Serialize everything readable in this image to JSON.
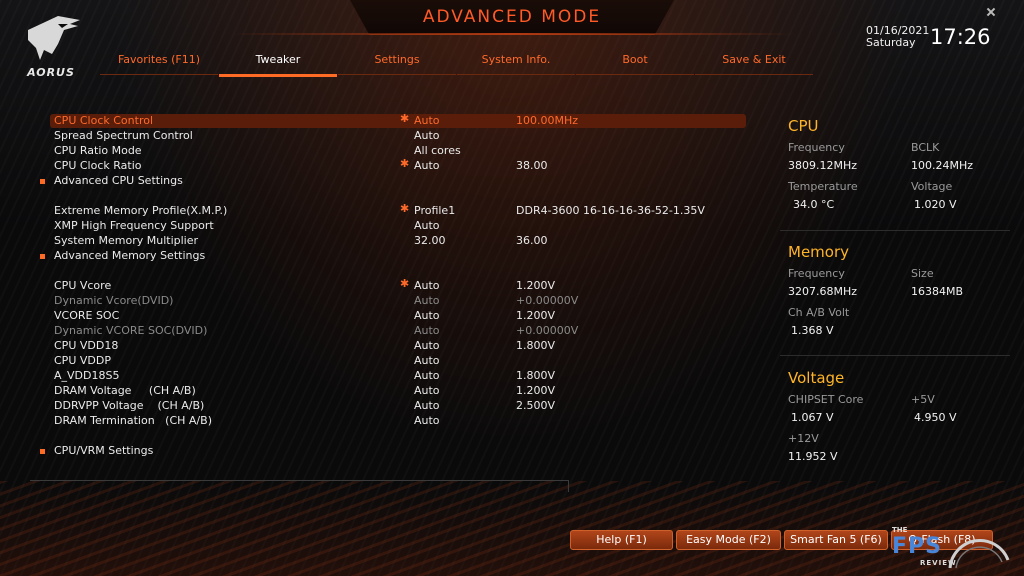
{
  "header": {
    "title": "ADVANCED MODE",
    "logo_text": "AORUS",
    "date": "01/16/2021",
    "weekday": "Saturday",
    "time": "17:26"
  },
  "tabs": [
    {
      "label": "Favorites (F11)",
      "active": false
    },
    {
      "label": "Tweaker",
      "active": true
    },
    {
      "label": "Settings",
      "active": false
    },
    {
      "label": "System Info.",
      "active": false
    },
    {
      "label": "Boot",
      "active": false
    },
    {
      "label": "Save & Exit",
      "active": false
    }
  ],
  "settings": [
    {
      "label": "CPU Clock Control",
      "star": true,
      "value": "Auto",
      "value2": "100.00MHz",
      "selected": true
    },
    {
      "label": "Spread Spectrum Control",
      "value": "Auto"
    },
    {
      "label": "CPU Ratio Mode",
      "value": "All cores"
    },
    {
      "label": "CPU Clock Ratio",
      "star": true,
      "value": "Auto",
      "value2": "38.00"
    },
    {
      "label": "Advanced CPU Settings",
      "submenu": true
    },
    {
      "label": "Extreme Memory Profile(X.M.P.)",
      "star": true,
      "value": "Profile1",
      "value2": "DDR4-3600 16-16-16-36-52-1.35V"
    },
    {
      "label": "XMP High Frequency Support",
      "value": "Auto"
    },
    {
      "label": "System Memory Multiplier",
      "value": "32.00",
      "value2": "36.00"
    },
    {
      "label": "Advanced Memory Settings",
      "submenu": true
    },
    {
      "label": "CPU Vcore",
      "star": true,
      "value": "Auto",
      "value2": "1.200V"
    },
    {
      "label": "Dynamic Vcore(DVID)",
      "value": "Auto",
      "value2": "+0.00000V",
      "dim": true
    },
    {
      "label": "VCORE SOC",
      "value": "Auto",
      "value2": "1.200V"
    },
    {
      "label": "Dynamic VCORE SOC(DVID)",
      "value": "Auto",
      "value2": "+0.00000V",
      "dim": true
    },
    {
      "label": "CPU VDD18",
      "value": "Auto",
      "value2": "1.800V"
    },
    {
      "label": "CPU VDDP",
      "value": "Auto"
    },
    {
      "label": "A_VDD18S5",
      "value": "Auto",
      "value2": "1.800V"
    },
    {
      "label": "DRAM Voltage     (CH A/B)",
      "value": "Auto",
      "value2": "1.200V"
    },
    {
      "label": "DDRVPP Voltage    (CH A/B)",
      "value": "Auto",
      "value2": "2.500V"
    },
    {
      "label": "DRAM Termination   (CH A/B)",
      "value": "Auto"
    },
    {
      "label": "CPU/VRM Settings",
      "submenu": true
    }
  ],
  "info": {
    "cpu": {
      "title": "CPU",
      "frequency_label": "Frequency",
      "frequency": "3809.12MHz",
      "bclk_label": "BCLK",
      "bclk": "100.24MHz",
      "temperature_label": "Temperature",
      "temperature": "34.0 °C",
      "voltage_label": "Voltage",
      "voltage": "1.020 V"
    },
    "memory": {
      "title": "Memory",
      "frequency_label": "Frequency",
      "frequency": "3207.68MHz",
      "size_label": "Size",
      "size": "16384MB",
      "chab_label": "Ch A/B Volt",
      "chab": "1.368 V"
    },
    "voltage": {
      "title": "Voltage",
      "chipset_label": "CHIPSET Core",
      "chipset": "1.067 V",
      "p5v_label": "+5V",
      "p5v": "4.950 V",
      "p12v_label": "+12V",
      "p12v": "11.952 V"
    }
  },
  "buttons": {
    "help": "Help (F1)",
    "easy": "Easy Mode (F2)",
    "smartfan": "Smart Fan 5 (F6)",
    "qflash": "Q-Flash (F8)"
  },
  "watermark": {
    "the": "THE",
    "fps": "FPS",
    "review": "REVIEW"
  },
  "colors": {
    "accent": "#ff6a2a",
    "info_title": "#ffb428",
    "selected_row": "#5a1d0a"
  }
}
